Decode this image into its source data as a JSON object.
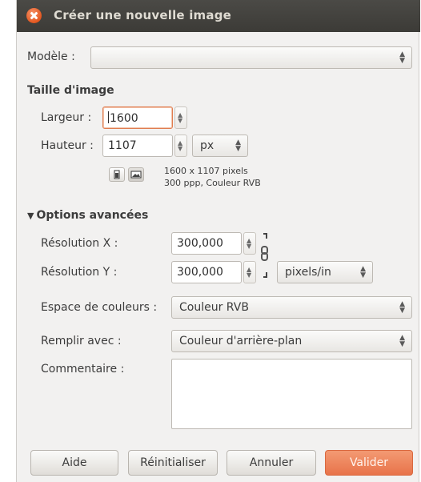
{
  "window": {
    "title": "Créer une nouvelle image"
  },
  "template": {
    "label": "Modèle :",
    "value": ""
  },
  "image_size": {
    "heading": "Taille d'image",
    "width_label": "Largeur :",
    "width_value": "1600",
    "height_label": "Hauteur :",
    "height_value": "1107",
    "unit": "px",
    "info_line1": "1600 x 1107 pixels",
    "info_line2": "300 ppp, Couleur RVB"
  },
  "advanced": {
    "heading": "Options avancées",
    "xres_label": "Résolution X :",
    "xres_value": "300,000",
    "yres_label": "Résolution Y :",
    "yres_value": "300,000",
    "res_unit": "pixels/in",
    "colorspace_label": "Espace de couleurs :",
    "colorspace_value": "Couleur RVB",
    "fill_label": "Remplir avec :",
    "fill_value": "Couleur d'arrière-plan",
    "comment_label": "Commentaire :",
    "comment_value": ""
  },
  "buttons": {
    "help": "Aide",
    "reset": "Réinitialiser",
    "cancel": "Annuler",
    "ok": "Valider"
  },
  "colors": {
    "accent": "#e8734a",
    "titlebar": "#3c3b37"
  }
}
